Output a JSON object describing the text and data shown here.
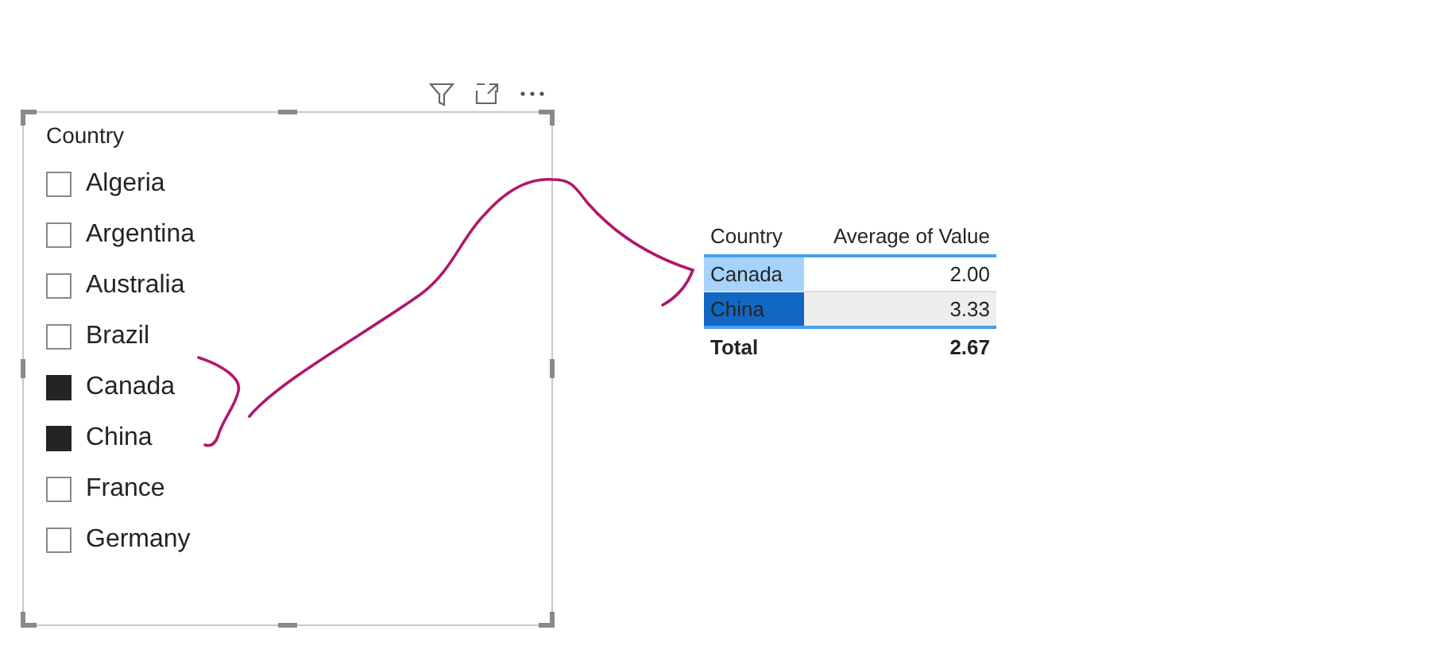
{
  "slicer": {
    "title": "Country",
    "items": [
      {
        "label": "Algeria",
        "checked": false
      },
      {
        "label": "Argentina",
        "checked": false
      },
      {
        "label": "Australia",
        "checked": false
      },
      {
        "label": "Brazil",
        "checked": false
      },
      {
        "label": "Canada",
        "checked": true
      },
      {
        "label": "China",
        "checked": true
      },
      {
        "label": "France",
        "checked": false
      },
      {
        "label": "Germany",
        "checked": false
      }
    ]
  },
  "table": {
    "columns": [
      "Country",
      "Average of Value"
    ],
    "rows": [
      {
        "country": "Canada",
        "value": "2.00",
        "color": "#a6d2fb"
      },
      {
        "country": "China",
        "value": "3.33",
        "color": "#1167c4"
      }
    ],
    "total": {
      "label": "Total",
      "value": "2.67"
    }
  }
}
